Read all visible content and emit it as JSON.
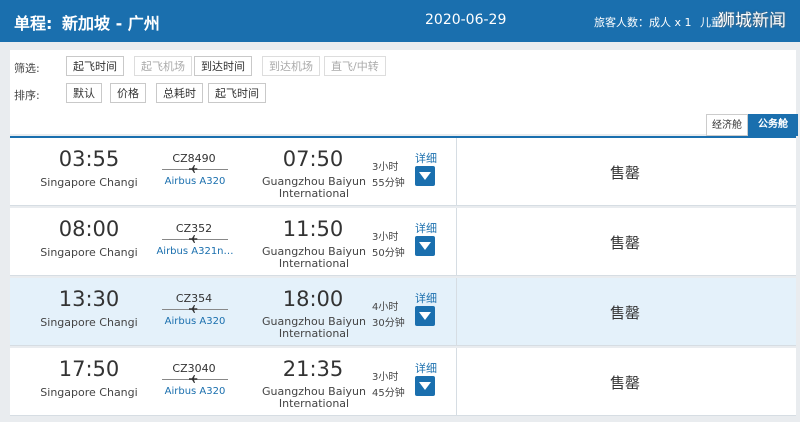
{
  "header": {
    "label": "单程:",
    "route": "新加坡 - 广州",
    "date": "2020-06-29",
    "passengers": "旅客人数：成人 x 1",
    "children": "儿童",
    "watermark": "狮城新闻"
  },
  "filters": {
    "filter_label": "筛选:",
    "filter_options": [
      "起飞时间",
      "起飞机场",
      "到达时间",
      "到达机场",
      "直飞/中转"
    ],
    "sort_label": "排序:",
    "sort_options": [
      "默认",
      "价格",
      "总耗时",
      "起飞时间"
    ]
  },
  "cabin_tabs": {
    "economy": "经济舱",
    "business": "公务舱",
    "selected": "business"
  },
  "flights": [
    {
      "dep_time": "03:55",
      "dep_airport": "Singapore Changi",
      "flight_no": "CZ8490",
      "aircraft": "Airbus A320",
      "arr_time": "07:50",
      "arr_airport_1": "Guangzhou Baiyun",
      "arr_airport_2": "International",
      "duration_h": "3小时",
      "duration_m": "55分钟",
      "detail": "详细",
      "status": "售罄"
    },
    {
      "dep_time": "08:00",
      "dep_airport": "Singapore Changi",
      "flight_no": "CZ352",
      "aircraft": "Airbus A321n…",
      "arr_time": "11:50",
      "arr_airport_1": "Guangzhou Baiyun",
      "arr_airport_2": "International",
      "duration_h": "3小时",
      "duration_m": "50分钟",
      "detail": "详细",
      "status": "售罄"
    },
    {
      "dep_time": "13:30",
      "dep_airport": "Singapore Changi",
      "flight_no": "CZ354",
      "aircraft": "Airbus A320",
      "arr_time": "18:00",
      "arr_airport_1": "Guangzhou Baiyun",
      "arr_airport_2": "International",
      "duration_h": "4小时",
      "duration_m": "30分钟",
      "detail": "详细",
      "status": "售罄"
    },
    {
      "dep_time": "17:50",
      "dep_airport": "Singapore Changi",
      "flight_no": "CZ3040",
      "aircraft": "Airbus A320",
      "arr_time": "21:35",
      "arr_airport_1": "Guangzhou Baiyun",
      "arr_airport_2": "International",
      "duration_h": "3小时",
      "duration_m": "45分钟",
      "detail": "详细",
      "status": "售罄"
    }
  ],
  "colors": {
    "brand": "#1a6fae",
    "highlight_row": "#e4f1fa"
  },
  "icons": {
    "plane": "plane-icon",
    "detail": "chevron-down-icon"
  }
}
